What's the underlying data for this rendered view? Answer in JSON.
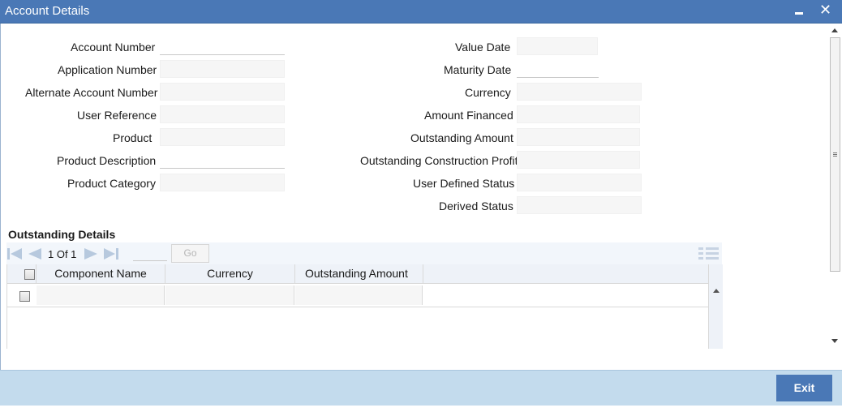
{
  "window": {
    "title": "Account Details",
    "minimize_glyph": "▬",
    "close_glyph": "✕"
  },
  "left_fields": [
    {
      "label": "Account Number",
      "value": ""
    },
    {
      "label": "Application Number",
      "value": ""
    },
    {
      "label": "Alternate Account Number",
      "value": ""
    },
    {
      "label": "User Reference",
      "value": ""
    },
    {
      "label": "Product",
      "value": ""
    },
    {
      "label": "Product Description",
      "value": ""
    },
    {
      "label": "Product Category",
      "value": ""
    }
  ],
  "right_fields": [
    {
      "label": "Value Date",
      "value": ""
    },
    {
      "label": "Maturity Date",
      "value": ""
    },
    {
      "label": "Currency",
      "value": ""
    },
    {
      "label": "Amount Financed",
      "value": ""
    },
    {
      "label": "Outstanding Amount",
      "value": ""
    },
    {
      "label": "Outstanding Construction Profit",
      "value": ""
    },
    {
      "label": "User Defined Status",
      "value": ""
    },
    {
      "label": "Derived Status",
      "value": ""
    }
  ],
  "outstanding": {
    "title": "Outstanding Details",
    "pager": {
      "text": "1 Of 1",
      "page_input": "",
      "go_label": "Go"
    },
    "columns": [
      "Component Name",
      "Currency",
      "Outstanding Amount"
    ],
    "rows": [
      [
        "",
        "",
        ""
      ]
    ]
  },
  "icons": {
    "first": "first-page-icon",
    "prev": "prev-page-icon",
    "next": "next-page-icon",
    "last": "last-page-icon",
    "list": "list-view-icon"
  },
  "colors": {
    "title_bar": "#4a78b6",
    "footer": "#c3dbed",
    "exit_button": "#4a78b6"
  },
  "footer": {
    "exit_label": "Exit"
  }
}
